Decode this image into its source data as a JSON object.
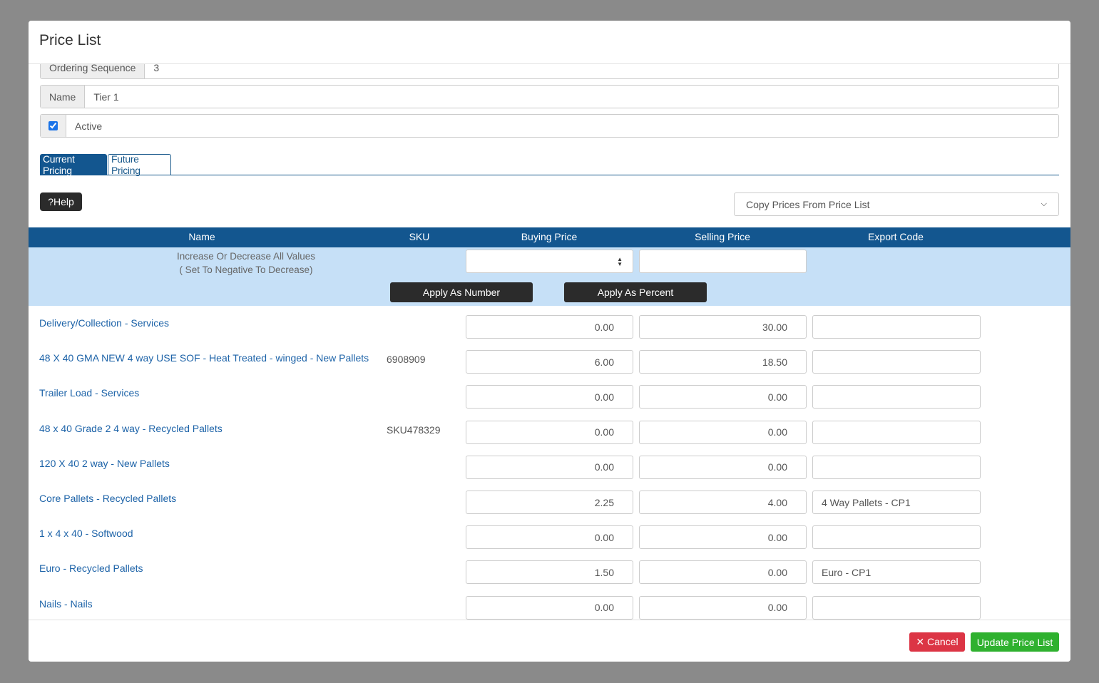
{
  "modal": {
    "title": "Price List"
  },
  "form": {
    "ordering_label": "Ordering Sequence",
    "ordering_value": "3",
    "name_label": "Name",
    "name_value": "Tier 1",
    "active_label": "Active",
    "active_checked": true
  },
  "tabs": [
    {
      "label": "Current Pricing",
      "active": true
    },
    {
      "label": "Future Pricing",
      "active": false
    }
  ],
  "help_label": "?Help",
  "copy_select": "Copy Prices From Price List",
  "columns": [
    "Name",
    "SKU",
    "Buying Price",
    "Selling Price",
    "Export Code"
  ],
  "bulk": {
    "line1": "Increase Or Decrease All Values",
    "line2": "( Set To Negative To Decrease)",
    "apply_number": "Apply As Number",
    "apply_percent": "Apply As Percent"
  },
  "rows": [
    {
      "name": "Delivery/Collection - Services",
      "sku": "",
      "buying": "0.00",
      "selling": "30.00",
      "export": ""
    },
    {
      "name": "48 X 40 GMA NEW 4 way USE SOF - Heat Treated - winged - New Pallets",
      "sku": "6908909",
      "buying": "6.00",
      "selling": "18.50",
      "export": ""
    },
    {
      "name": "Trailer Load - Services",
      "sku": "",
      "buying": "0.00",
      "selling": "0.00",
      "export": ""
    },
    {
      "name": "48 x 40 Grade 2 4 way - Recycled Pallets",
      "sku": "SKU478329",
      "buying": "0.00",
      "selling": "0.00",
      "export": ""
    },
    {
      "name": "120 X 40 2 way - New Pallets",
      "sku": "",
      "buying": "0.00",
      "selling": "0.00",
      "export": ""
    },
    {
      "name": "Core Pallets - Recycled Pallets",
      "sku": "",
      "buying": "2.25",
      "selling": "4.00",
      "export": "4 Way Pallets - CP1"
    },
    {
      "name": "1 x 4 x 40 - Softwood",
      "sku": "",
      "buying": "0.00",
      "selling": "0.00",
      "export": ""
    },
    {
      "name": "Euro - Recycled Pallets",
      "sku": "",
      "buying": "1.50",
      "selling": "0.00",
      "export": "Euro - CP1"
    },
    {
      "name": "Nails - Nails",
      "sku": "",
      "buying": "0.00",
      "selling": "0.00",
      "export": ""
    }
  ],
  "footer": {
    "cancel": "✕ Cancel",
    "update": "Update Price List"
  },
  "colors": {
    "primary": "#13568f",
    "bulk_bg": "#c6e0f7",
    "cancel": "#dc3545",
    "update": "#2fb12f"
  }
}
